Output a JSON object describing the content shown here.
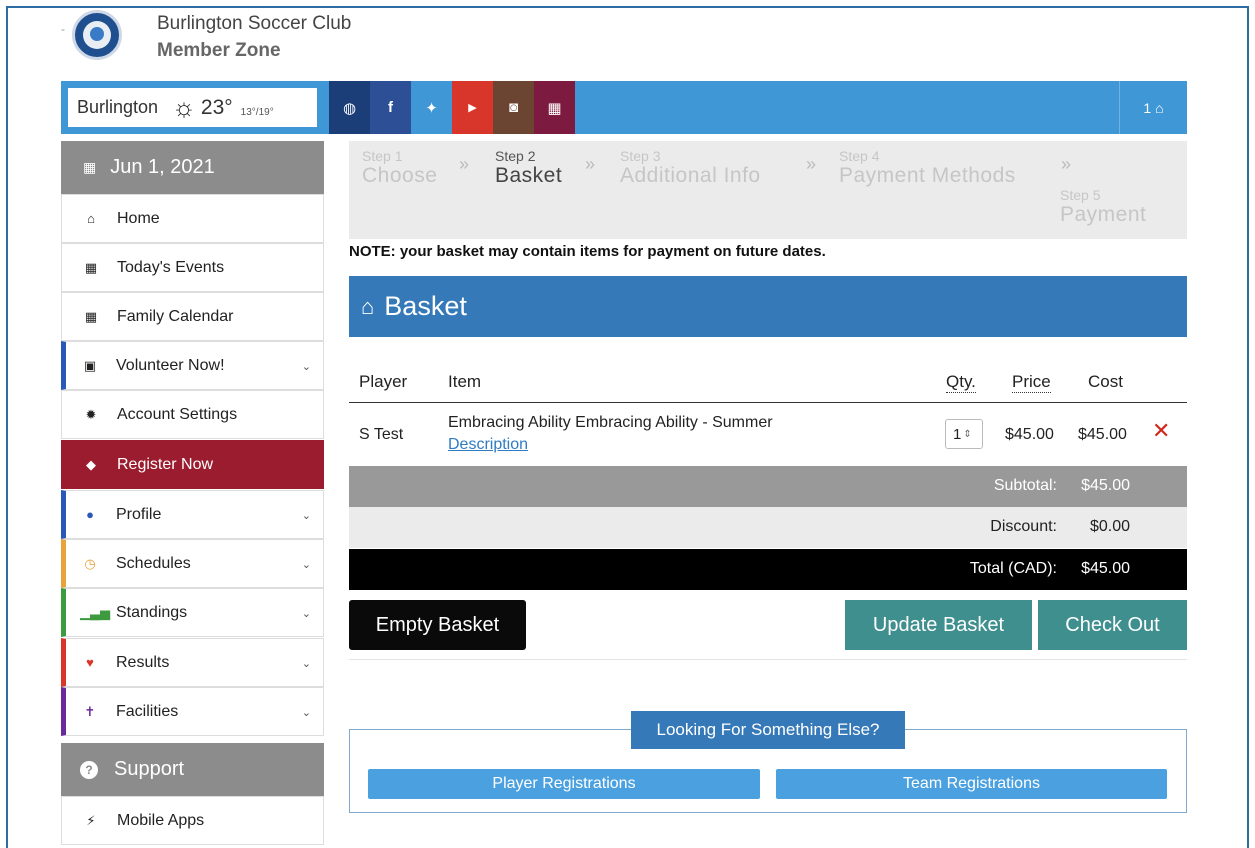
{
  "header": {
    "club_name": "Burlington Soccer Club",
    "club_sub": "Member Zone"
  },
  "topbar": {
    "city": "Burlington",
    "weather_icon": "sun-icon",
    "temp": "23°",
    "range": "13°/19°",
    "social": [
      {
        "name": "globe-icon",
        "glyph": "🌐",
        "color": "#1b3d78"
      },
      {
        "name": "facebook-icon",
        "glyph": "f",
        "color": "#2c4f96"
      },
      {
        "name": "twitter-icon",
        "glyph": "🐦",
        "color": "#3f97d6"
      },
      {
        "name": "youtube-icon",
        "glyph": "▶",
        "color": "#d9362b"
      },
      {
        "name": "instagram-icon",
        "glyph": "◙",
        "color": "#6b4432"
      },
      {
        "name": "calendar-icon",
        "glyph": "▦",
        "color": "#7d1a3f"
      }
    ],
    "cart_count": "1",
    "accent": "#3f97d6"
  },
  "sidebar": {
    "date": "Jun 1, 2021",
    "items": [
      {
        "label": "Home",
        "icon": "home-icon"
      },
      {
        "label": "Today's Events",
        "icon": "calendar-icon"
      },
      {
        "label": "Family Calendar",
        "icon": "calendar-icon"
      },
      {
        "label": "Volunteer Now!",
        "icon": "inbox-icon"
      },
      {
        "label": "Account Settings",
        "icon": "gear-icon"
      },
      {
        "label": "Register Now",
        "icon": "tag-icon"
      },
      {
        "label": "Profile",
        "icon": "user-icon"
      },
      {
        "label": "Schedules",
        "icon": "clock-icon"
      },
      {
        "label": "Standings",
        "icon": "bar-chart-icon"
      },
      {
        "label": "Results",
        "icon": "trophy-icon"
      },
      {
        "label": "Facilities",
        "icon": "signpost-icon"
      }
    ],
    "support": "Support",
    "mobile_apps": "Mobile Apps"
  },
  "steps": [
    {
      "num": "Step 1",
      "title": "Choose"
    },
    {
      "num": "Step 2",
      "title": "Basket"
    },
    {
      "num": "Step 3",
      "title": "Additional Info"
    },
    {
      "num": "Step 4",
      "title": "Payment Methods"
    },
    {
      "num": "Step 5",
      "title": "Payment"
    }
  ],
  "note": "NOTE: your basket may contain items for payment on future dates.",
  "basket": {
    "title": "Basket",
    "columns": [
      "Player",
      "Item",
      "Qty.",
      "Price",
      "Cost"
    ],
    "row": {
      "player": "S Test",
      "item": "Embracing Ability Embracing Ability - Summer",
      "description_link": "Description",
      "qty": "1",
      "price": "$45.00",
      "cost": "$45.00"
    },
    "subtotal_label": "Subtotal:",
    "subtotal": "$45.00",
    "discount_label": "Discount:",
    "discount": "$0.00",
    "total_label": "Total (CAD):",
    "total": "$45.00"
  },
  "buttons": {
    "empty": "Empty Basket",
    "update": "Update Basket",
    "checkout": "Check Out"
  },
  "looking": {
    "title": "Looking For Something Else?",
    "player_reg": "Player Registrations",
    "team_reg": "Team Registrations"
  }
}
